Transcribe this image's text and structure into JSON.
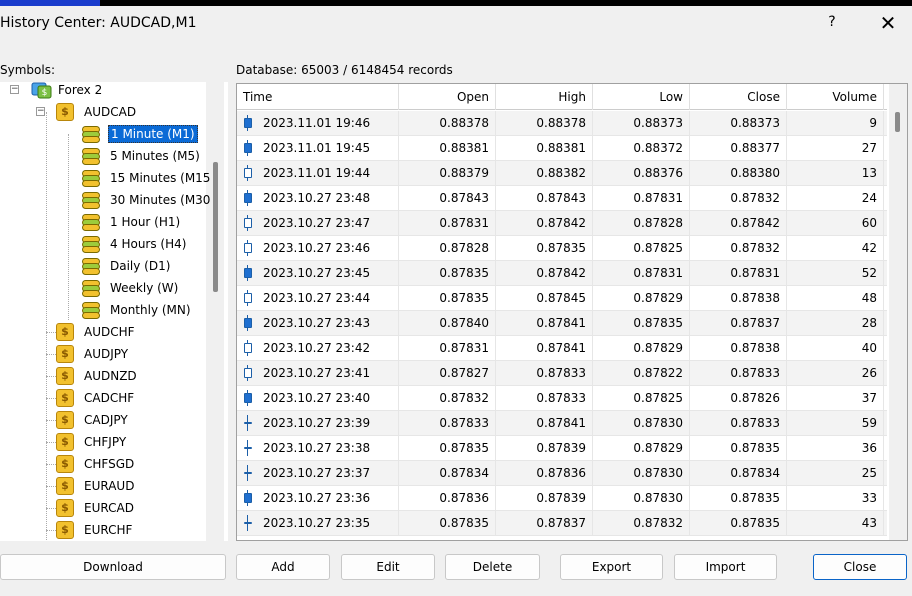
{
  "window": {
    "title": "History Center: AUDCAD,M1",
    "help": "?",
    "close_glyph": "✕"
  },
  "labels": {
    "symbols": "Symbols:",
    "database": "Database: 65003 / 6148454 records"
  },
  "tree": {
    "root": "Forex 2",
    "expanded_symbol": "AUDCAD",
    "timeframes": [
      "1 Minute (M1)",
      "5 Minutes (M5)",
      "15 Minutes (M15",
      "30 Minutes (M30",
      "1 Hour (H1)",
      "4 Hours (H4)",
      "Daily (D1)",
      "Weekly (W)",
      "Monthly (MN)"
    ],
    "selected_timeframe": "1 Minute (M1)",
    "symbols": [
      "AUDCHF",
      "AUDJPY",
      "AUDNZD",
      "CADCHF",
      "CADJPY",
      "CHFJPY",
      "CHFSGD",
      "EURAUD",
      "EURCAD",
      "EURCHF"
    ]
  },
  "table": {
    "columns": [
      "Time",
      "Open",
      "High",
      "Low",
      "Close",
      "Volume"
    ],
    "rows": [
      {
        "candle": "bear",
        "time": "2023.11.01 19:46",
        "open": "0.88378",
        "high": "0.88378",
        "low": "0.88373",
        "close": "0.88373",
        "volume": "9"
      },
      {
        "candle": "bear",
        "time": "2023.11.01 19:45",
        "open": "0.88381",
        "high": "0.88381",
        "low": "0.88372",
        "close": "0.88377",
        "volume": "27"
      },
      {
        "candle": "bull",
        "time": "2023.11.01 19:44",
        "open": "0.88379",
        "high": "0.88382",
        "low": "0.88376",
        "close": "0.88380",
        "volume": "13"
      },
      {
        "candle": "bear",
        "time": "2023.10.27 23:48",
        "open": "0.87843",
        "high": "0.87843",
        "low": "0.87831",
        "close": "0.87832",
        "volume": "24"
      },
      {
        "candle": "bull",
        "time": "2023.10.27 23:47",
        "open": "0.87831",
        "high": "0.87842",
        "low": "0.87828",
        "close": "0.87842",
        "volume": "60"
      },
      {
        "candle": "bull",
        "time": "2023.10.27 23:46",
        "open": "0.87828",
        "high": "0.87835",
        "low": "0.87825",
        "close": "0.87832",
        "volume": "42"
      },
      {
        "candle": "bear",
        "time": "2023.10.27 23:45",
        "open": "0.87835",
        "high": "0.87842",
        "low": "0.87831",
        "close": "0.87831",
        "volume": "52"
      },
      {
        "candle": "bull",
        "time": "2023.10.27 23:44",
        "open": "0.87835",
        "high": "0.87845",
        "low": "0.87829",
        "close": "0.87838",
        "volume": "48"
      },
      {
        "candle": "bear",
        "time": "2023.10.27 23:43",
        "open": "0.87840",
        "high": "0.87841",
        "low": "0.87835",
        "close": "0.87837",
        "volume": "28"
      },
      {
        "candle": "bull",
        "time": "2023.10.27 23:42",
        "open": "0.87831",
        "high": "0.87841",
        "low": "0.87829",
        "close": "0.87838",
        "volume": "40"
      },
      {
        "candle": "bull",
        "time": "2023.10.27 23:41",
        "open": "0.87827",
        "high": "0.87833",
        "low": "0.87822",
        "close": "0.87833",
        "volume": "26"
      },
      {
        "candle": "bear",
        "time": "2023.10.27 23:40",
        "open": "0.87832",
        "high": "0.87833",
        "low": "0.87825",
        "close": "0.87826",
        "volume": "37"
      },
      {
        "candle": "doji",
        "time": "2023.10.27 23:39",
        "open": "0.87833",
        "high": "0.87841",
        "low": "0.87830",
        "close": "0.87833",
        "volume": "59"
      },
      {
        "candle": "doji",
        "time": "2023.10.27 23:38",
        "open": "0.87835",
        "high": "0.87839",
        "low": "0.87829",
        "close": "0.87835",
        "volume": "36"
      },
      {
        "candle": "doji",
        "time": "2023.10.27 23:37",
        "open": "0.87834",
        "high": "0.87836",
        "low": "0.87830",
        "close": "0.87834",
        "volume": "25"
      },
      {
        "candle": "bear",
        "time": "2023.10.27 23:36",
        "open": "0.87836",
        "high": "0.87839",
        "low": "0.87830",
        "close": "0.87835",
        "volume": "33"
      },
      {
        "candle": "doji",
        "time": "2023.10.27 23:35",
        "open": "0.87835",
        "high": "0.87837",
        "low": "0.87832",
        "close": "0.87835",
        "volume": "43"
      }
    ]
  },
  "buttons": {
    "download": "Download",
    "add": "Add",
    "edit": "Edit",
    "delete": "Delete",
    "export": "Export",
    "import": "Import",
    "close": "Close"
  },
  "colors": {
    "selection": "#0a6ad6",
    "candle": "#1f6fd0",
    "coin": "#f2c12e",
    "stack": "#9ccc3c"
  }
}
